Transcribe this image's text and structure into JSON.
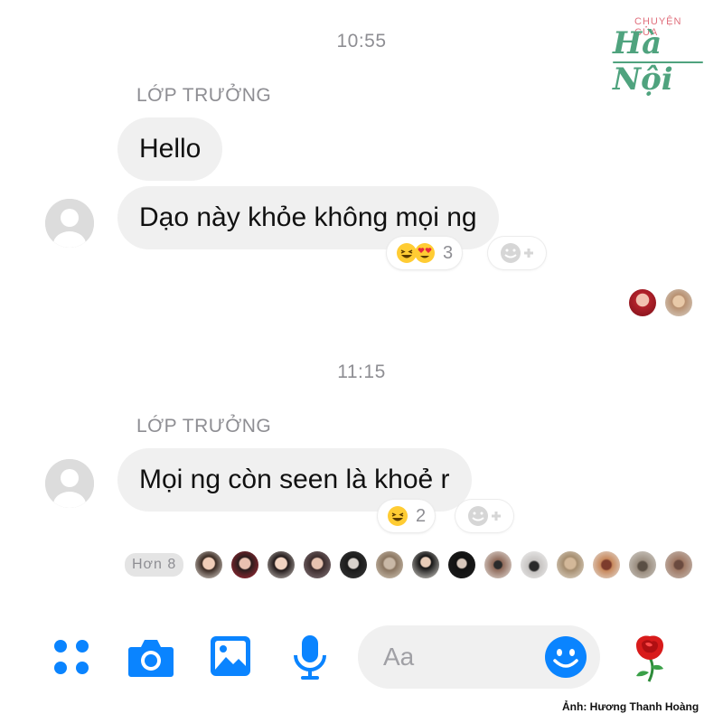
{
  "logo": {
    "top_text": "CHUYỆN CỦA",
    "main_text": "Hà Nội"
  },
  "thread": [
    {
      "time": "10:55",
      "sender": "LỚP TRƯỞNG",
      "messages": [
        "Hello",
        "Dạo này khỏe không mọi ng"
      ],
      "reaction": {
        "emojis": [
          "grinning-squint-face",
          "heart-eyes-face"
        ],
        "count": "3"
      }
    },
    {
      "time": "11:15",
      "sender": "LỚP TRƯỞNG",
      "messages": [
        "Mọi ng còn seen là khoẻ r"
      ],
      "reaction": {
        "emojis": [
          "grinning-squint-face"
        ],
        "count": "2"
      },
      "seen_more_label": "Hơn 8"
    }
  ],
  "composer": {
    "placeholder": "Aa"
  },
  "credit": "Ảnh: Hương Thanh Hoàng",
  "colors": {
    "accent": "#0a84ff",
    "bubble": "#f0f0f0",
    "meta_text": "#8e8e93",
    "logo_green": "#4fa37e",
    "logo_pink": "#e06f7c"
  }
}
